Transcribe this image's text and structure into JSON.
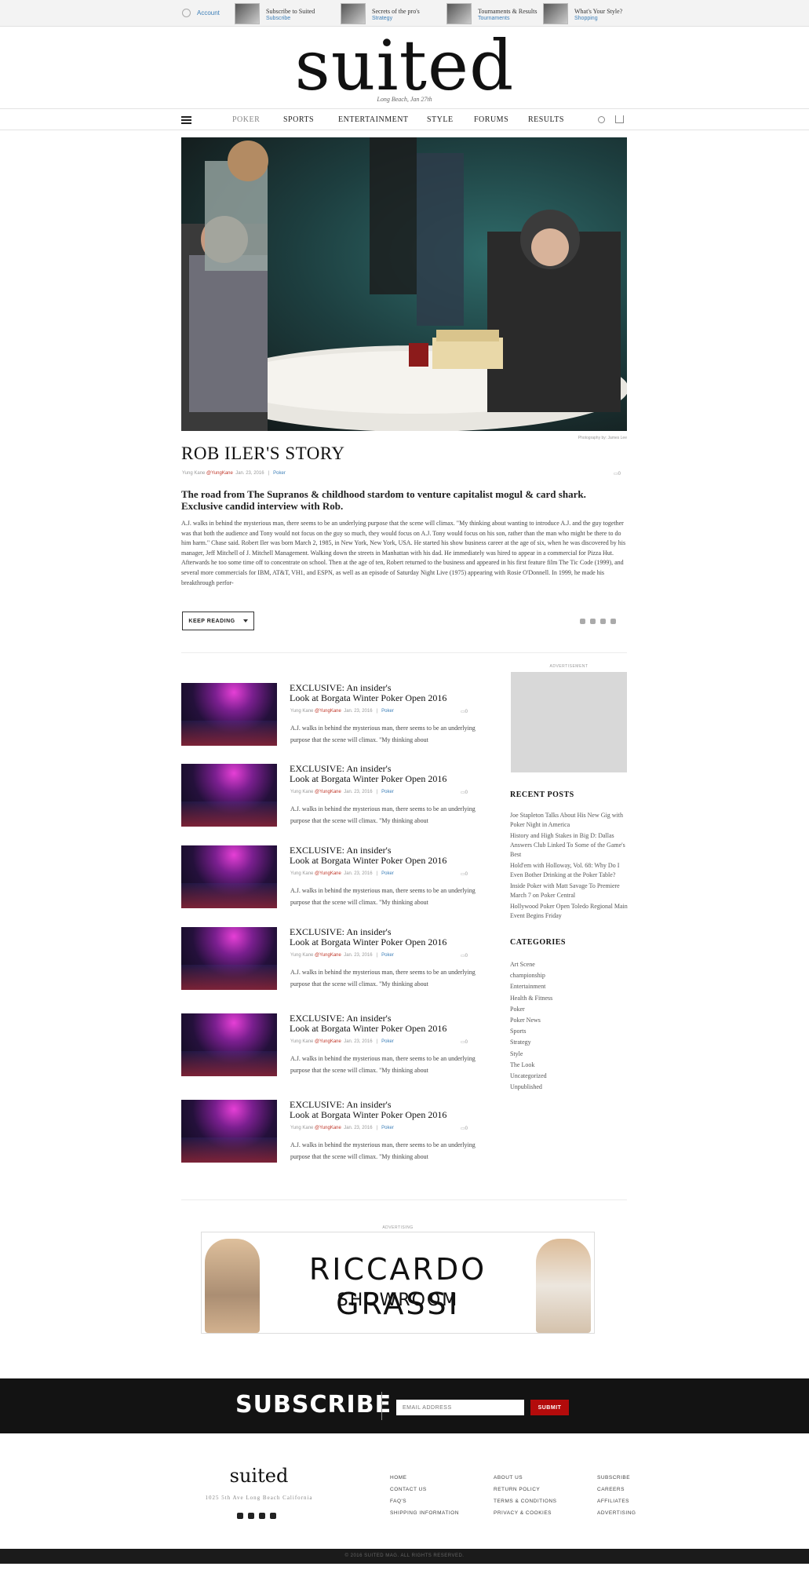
{
  "topbar": {
    "account_label": "Account",
    "promos": [
      {
        "title": "Subscribe to Suited",
        "sub": "Subscribe"
      },
      {
        "title": "Secrets of the pro's",
        "sub": "Strategy"
      },
      {
        "title": "Tournaments & Results",
        "sub": "Tournaments"
      },
      {
        "title": "What's Your Style?",
        "sub": "Shopping"
      }
    ]
  },
  "masthead": {
    "logo": "suited",
    "dateline": "Long Beach, Jan 27th"
  },
  "nav": {
    "items": [
      "POKER",
      "SPORTS",
      "ENTERTAINMENT",
      "STYLE",
      "FORUMS",
      "RESULTS"
    ]
  },
  "hero": {
    "credit": "Photography by: James Lee"
  },
  "article": {
    "title": "ROB ILER'S STORY",
    "author": "Yung Kane",
    "handle": "@YungKane",
    "date": "Jan. 23, 2016",
    "sep": "|",
    "category": "Poker",
    "comments": "0",
    "subtitle": "The road from The Supranos & childhood stardom to venture capitalist mogul & card shark. Exclusive candid interview with Rob.",
    "body": "A.J. walks in behind the mysterious man, there seems to be an underlying purpose that the scene will climax. \"My thinking about wanting to introduce A.J. and the guy together was that both the audience and Tony would not focus on the guy so much, they would focus on A.J. Tony would focus on his son, rather than the man who might be there to do him harm.\" Chase said. Robert Iler was born March 2, 1985, in New York, New York, USA. He started his show business career at the age of six, when he was discovered by his manager, Jeff Mitchell of J. Mitchell Management. Walking down the streets in Manhattan with his dad. He immediately was hired to appear in a commercial for Pizza Hut. Afterwards he too some time off to concentrate on school. Then at the age of ten, Robert returned to the business and appeared in his first feature film The Tic Code (1999), and several more commercials for IBM, AT&T, VH1, and ESPN, as well as an episode of Saturday Night Live (1975) appearing with Rosie O'Donnell. In 1999, he made his breakthrough perfor-",
    "keep_reading": "KEEP READING"
  },
  "posts": [
    {
      "title1": "EXCLUSIVE: An insider's",
      "title2": "Look at Borgata Winter Poker Open 2016",
      "author": "Yung Kane",
      "handle": "@YungKane",
      "date": "Jan. 23, 2016",
      "sep": "|",
      "category": "Poker",
      "comments": "0",
      "excerpt": "A.J. walks in behind the mysterious man, there seems to be an underlying purpose that the scene will climax. \"My thinking about"
    },
    {
      "title1": "EXCLUSIVE: An insider's",
      "title2": "Look at Borgata Winter Poker Open 2016",
      "author": "Yung Kane",
      "handle": "@YungKane",
      "date": "Jan. 23, 2016",
      "sep": "|",
      "category": "Poker",
      "comments": "0",
      "excerpt": "A.J. walks in behind the mysterious man, there seems to be an underlying purpose that the scene will climax. \"My thinking about"
    },
    {
      "title1": "EXCLUSIVE: An insider's",
      "title2": "Look at Borgata Winter Poker Open 2016",
      "author": "Yung Kane",
      "handle": "@YungKane",
      "date": "Jan. 23, 2016",
      "sep": "|",
      "category": "Poker",
      "comments": "0",
      "excerpt": "A.J. walks in behind the mysterious man, there seems to be an underlying purpose that the scene will climax. \"My thinking about"
    },
    {
      "title1": "EXCLUSIVE: An insider's",
      "title2": "Look at Borgata Winter Poker Open 2016",
      "author": "Yung Kane",
      "handle": "@YungKane",
      "date": "Jan. 23, 2016",
      "sep": "|",
      "category": "Poker",
      "comments": "0",
      "excerpt": "A.J. walks in behind the mysterious man, there seems to be an underlying purpose that the scene will climax. \"My thinking about"
    },
    {
      "title1": "EXCLUSIVE: An insider's",
      "title2": "Look at Borgata Winter Poker Open 2016",
      "author": "Yung Kane",
      "handle": "@YungKane",
      "date": "Jan. 23, 2016",
      "sep": "|",
      "category": "Poker",
      "comments": "0",
      "excerpt": "A.J. walks in behind the mysterious man, there seems to be an underlying purpose that the scene will climax. \"My thinking about"
    },
    {
      "title1": "EXCLUSIVE: An insider's",
      "title2": "Look at Borgata Winter Poker Open 2016",
      "author": "Yung Kane",
      "handle": "@YungKane",
      "date": "Jan. 23, 2016",
      "sep": "|",
      "category": "Poker",
      "comments": "0",
      "excerpt": "A.J. walks in behind the mysterious man, there seems to be an underlying purpose that the scene will climax. \"My thinking about"
    }
  ],
  "sidebar": {
    "ad_label": "ADVERTISEMENT",
    "recent_title": "RECENT POSTS",
    "recent": [
      "Joe Stapleton Talks About His New Gig with Poker Night in America",
      "History and High Stakes in Big D: Dallas Answers Club Linked To Some of the Game's Best",
      "Hold'em with Holloway, Vol. 68: Why Do I Even Bother Drinking at the Poker Table?",
      "Inside Poker with Matt Savage To Premiere March 7 on Poker Central",
      "Hollywood Poker Open Toledo Regional Main Event Begins Friday"
    ],
    "categories_title": "CATEGORIES",
    "categories": [
      "Art Scene",
      "championship",
      "Entertainment",
      "Health & Fitness",
      "Poker",
      "Poker News",
      "Sports",
      "Strategy",
      "Style",
      "The Look",
      "Uncategorized",
      "Unpublished"
    ]
  },
  "banner": {
    "label": "ADVERTISING",
    "line1": "RICCARDO GRASSI",
    "line2": "SHOWROOM"
  },
  "subscribe": {
    "title": "SUBSCRIBE",
    "email_placeholder": "EMAIL ADDRESS",
    "button": "SUBMIT"
  },
  "footer": {
    "logo": "suited",
    "address": "1025 5th Ave Long Beach California",
    "col1": [
      "HOME",
      "CONTACT US",
      "FAQ'S",
      "SHIPPING INFORMATION"
    ],
    "col2": [
      "ABOUT US",
      "RETURN POLICY",
      "TERMS & CONDITIONS",
      "PRIVACY & COOKIES"
    ],
    "col3": [
      "SUBSCRIBE",
      "CAREERS",
      "AFFILIATES",
      "ADVERTISING"
    ],
    "copyright": "© 2016 SUITED MAG. ALL RIGHTS RESERVED."
  },
  "colors": {
    "accent": "#3d7fb8",
    "handle": "#c0392b",
    "submit": "#b30b0b",
    "dark": "#131313"
  }
}
